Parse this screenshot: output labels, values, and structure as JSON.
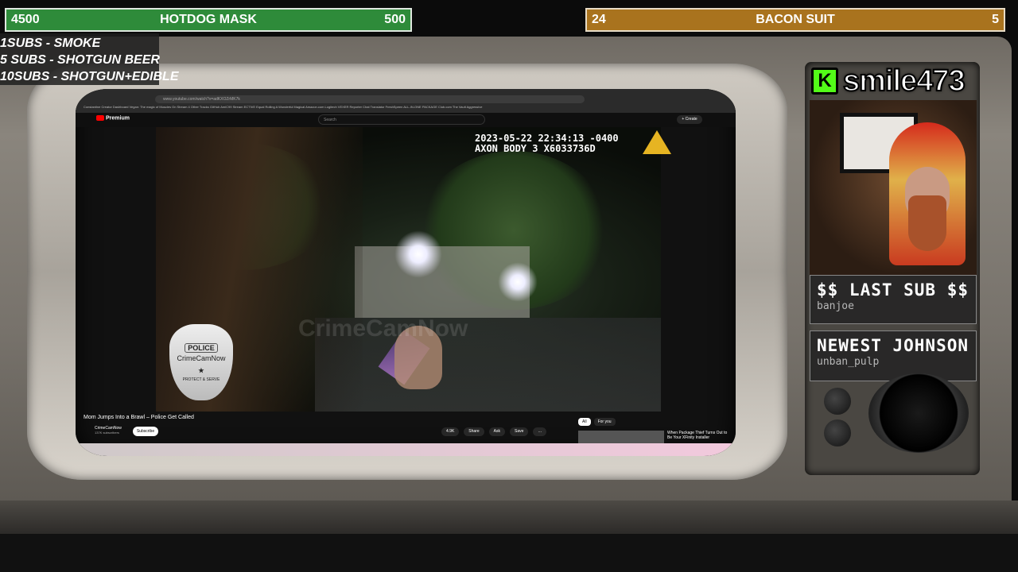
{
  "goals": {
    "left": {
      "current": "4500",
      "title": "HOTDOG MASK",
      "target": "500"
    },
    "right": {
      "current": "24",
      "title": "BACON SUIT",
      "target": "5"
    }
  },
  "sub_goals": [
    "1SUBS   - SMOKE",
    "5 SUBS  - SHOTGUN BEER",
    "10SUBS - SHOTGUN+EDIBLE"
  ],
  "browser": {
    "url": "www.youtube.com/watch?v=adKXOZrMK7k",
    "bookmarks": "Constantine  Creator Dashboard  Vegan: The magic of  Muscles On Stream  4 Other Tracks  GitHub  AmiC99 Stream  ECTIVE Equal Rolling  A Wonderful Magical  Amazon.com Logitech  VEXER Reporter  Chat Translator  FreshSpeen  ALL-IN-ONE PACKAGE  Club.com  The Vault Aggressive"
  },
  "youtube": {
    "logo": "Premium",
    "search_placeholder": "Search",
    "create_label": "+ Create",
    "video_title": "Mom Jumps Into a Brawl – Police Get Called",
    "channel": "CrimeCamNow",
    "channel_subs": "137K subscribers",
    "subscribe_label": "Subscribe",
    "like_count": "4.9K",
    "share_label": "Share",
    "ask_label": "Ask",
    "save_label": "Save",
    "more_label": "…",
    "chips": [
      "All",
      "For you"
    ],
    "rec_title": "When Package Thief Turns Out to Be Your XFinity Installer"
  },
  "video_overlay": {
    "timestamp": "2023-05-22 22:34:13 -0400",
    "device": "AXON BODY 3 X6033736D",
    "watermark": "CrimeCamNow",
    "badge": {
      "top": "POLICE",
      "name": "CrimeCamNow",
      "bottom": "PROTECT & SERVE"
    }
  },
  "streamer": {
    "platform_icon": "K",
    "username": "smile473"
  },
  "last_sub": {
    "heading": "$$ LAST SUB $$",
    "name": "banjoe"
  },
  "newest": {
    "heading": "NEWEST JOHNSON",
    "name": "unban_pulp"
  }
}
